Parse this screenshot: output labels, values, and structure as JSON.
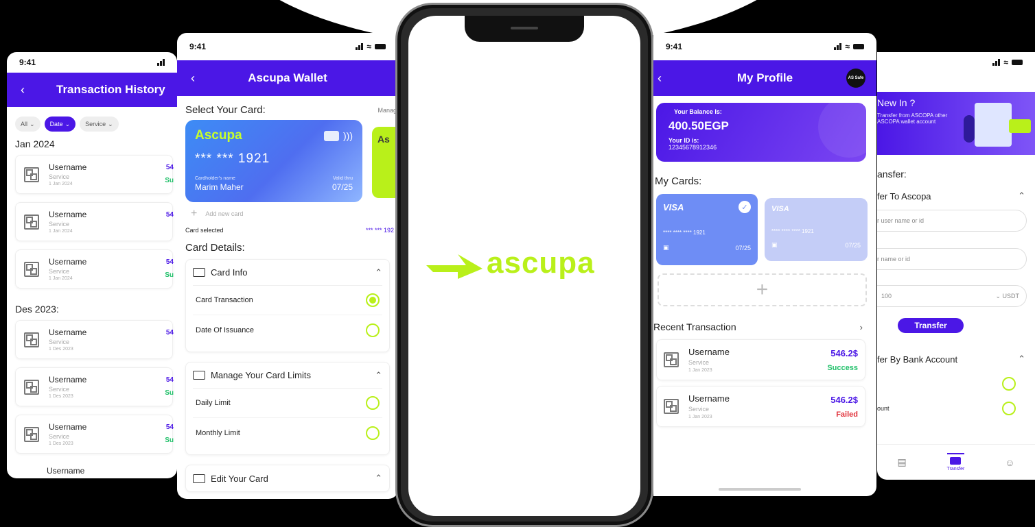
{
  "colors": {
    "brand": "#4b17e6",
    "accent": "#b9f01a",
    "success": "#21c06a",
    "failed": "#e0313a"
  },
  "history": {
    "time": "9:41",
    "title": "Transaction History",
    "filters": [
      "All",
      "Date",
      "Service"
    ],
    "groups": [
      {
        "month": "Jan 2024",
        "items": [
          {
            "name": "Username",
            "service": "Service",
            "date": "1 Jan 2024",
            "amount": "54",
            "status": "Su"
          },
          {
            "name": "Username",
            "service": "Service",
            "date": "1 Jan 2024",
            "amount": "54",
            "status": ""
          },
          {
            "name": "Username",
            "service": "Service",
            "date": "1 Jan 2024",
            "amount": "54",
            "status": "Su"
          }
        ]
      },
      {
        "month": "Des 2023:",
        "items": [
          {
            "name": "Username",
            "service": "Service",
            "date": "1 Des 2023",
            "amount": "54",
            "status": ""
          },
          {
            "name": "Username",
            "service": "Service",
            "date": "1 Des 2023",
            "amount": "54",
            "status": "Su"
          },
          {
            "name": "Username",
            "service": "Service",
            "date": "1 Des 2023",
            "amount": "54",
            "status": "Su"
          }
        ]
      }
    ],
    "partial_item": "Username"
  },
  "wallet": {
    "time": "9:41",
    "title": "Ascupa Wallet",
    "select_label": "Select Your Card:",
    "manage_label": "Manag",
    "card": {
      "brand": "Ascupa",
      "number": "*** *** 1921",
      "holder_label": "Cardholder's name",
      "holder": "Marim Maher",
      "valid_label": "Valid thru",
      "valid": "07/25"
    },
    "card2_brand": "As",
    "add_card": "Add new card",
    "card_selected_label": "Card selected",
    "card_selected_value": "*** *** 192",
    "details_label": "Card Details:",
    "sections": [
      {
        "title": "Card Info",
        "rows": [
          {
            "label": "Card Transaction",
            "on": true
          },
          {
            "label": "Date Of Issuance",
            "on": false
          }
        ]
      },
      {
        "title": "Manage Your Card Limits",
        "rows": [
          {
            "label": "Daily Limit",
            "on": false
          },
          {
            "label": "Monthly Limit",
            "on": false
          }
        ]
      },
      {
        "title": "Edit Your Card",
        "rows": []
      }
    ]
  },
  "splash": {
    "logo_text": "ascupa"
  },
  "profile": {
    "time": "9:41",
    "title": "My Profile",
    "avatar_text": "AS Safe",
    "balance_label": "Your Balance Is:",
    "balance": "400.50EGP",
    "id_label": "Your ID is:",
    "id_value": "12345678912346",
    "cards_label": "My Cards:",
    "cards": [
      {
        "brand": "VISA",
        "number": "**** **** **** 1921",
        "valid": "07/25"
      },
      {
        "brand": "VISA",
        "number": "**** **** **** 1921",
        "valid": "07/25"
      }
    ],
    "recent_label": "Recent Transaction",
    "transactions": [
      {
        "name": "Username",
        "service": "Service",
        "date": "1 Jan 2023",
        "amount": "546.2$",
        "status": "Success"
      },
      {
        "name": "Username",
        "service": "Service",
        "date": "1 Jan 2023",
        "amount": "546.2$",
        "status": "Failed"
      }
    ]
  },
  "transfer": {
    "banner_title": "New In ?",
    "banner_text": "Transfer from ASCOPA other ASCOPA wallet account",
    "section_label": "ansfer:",
    "to_ascopa": "fer To Ascopa",
    "input1_placeholder": "r user name or id",
    "input2_placeholder": "r name or id",
    "amount_value": "100",
    "currency": "USDT",
    "transfer_button": "Transfer",
    "by_bank": "fer By Bank Account",
    "bank_row2": "ount",
    "nav_transfer": "Transfer"
  }
}
